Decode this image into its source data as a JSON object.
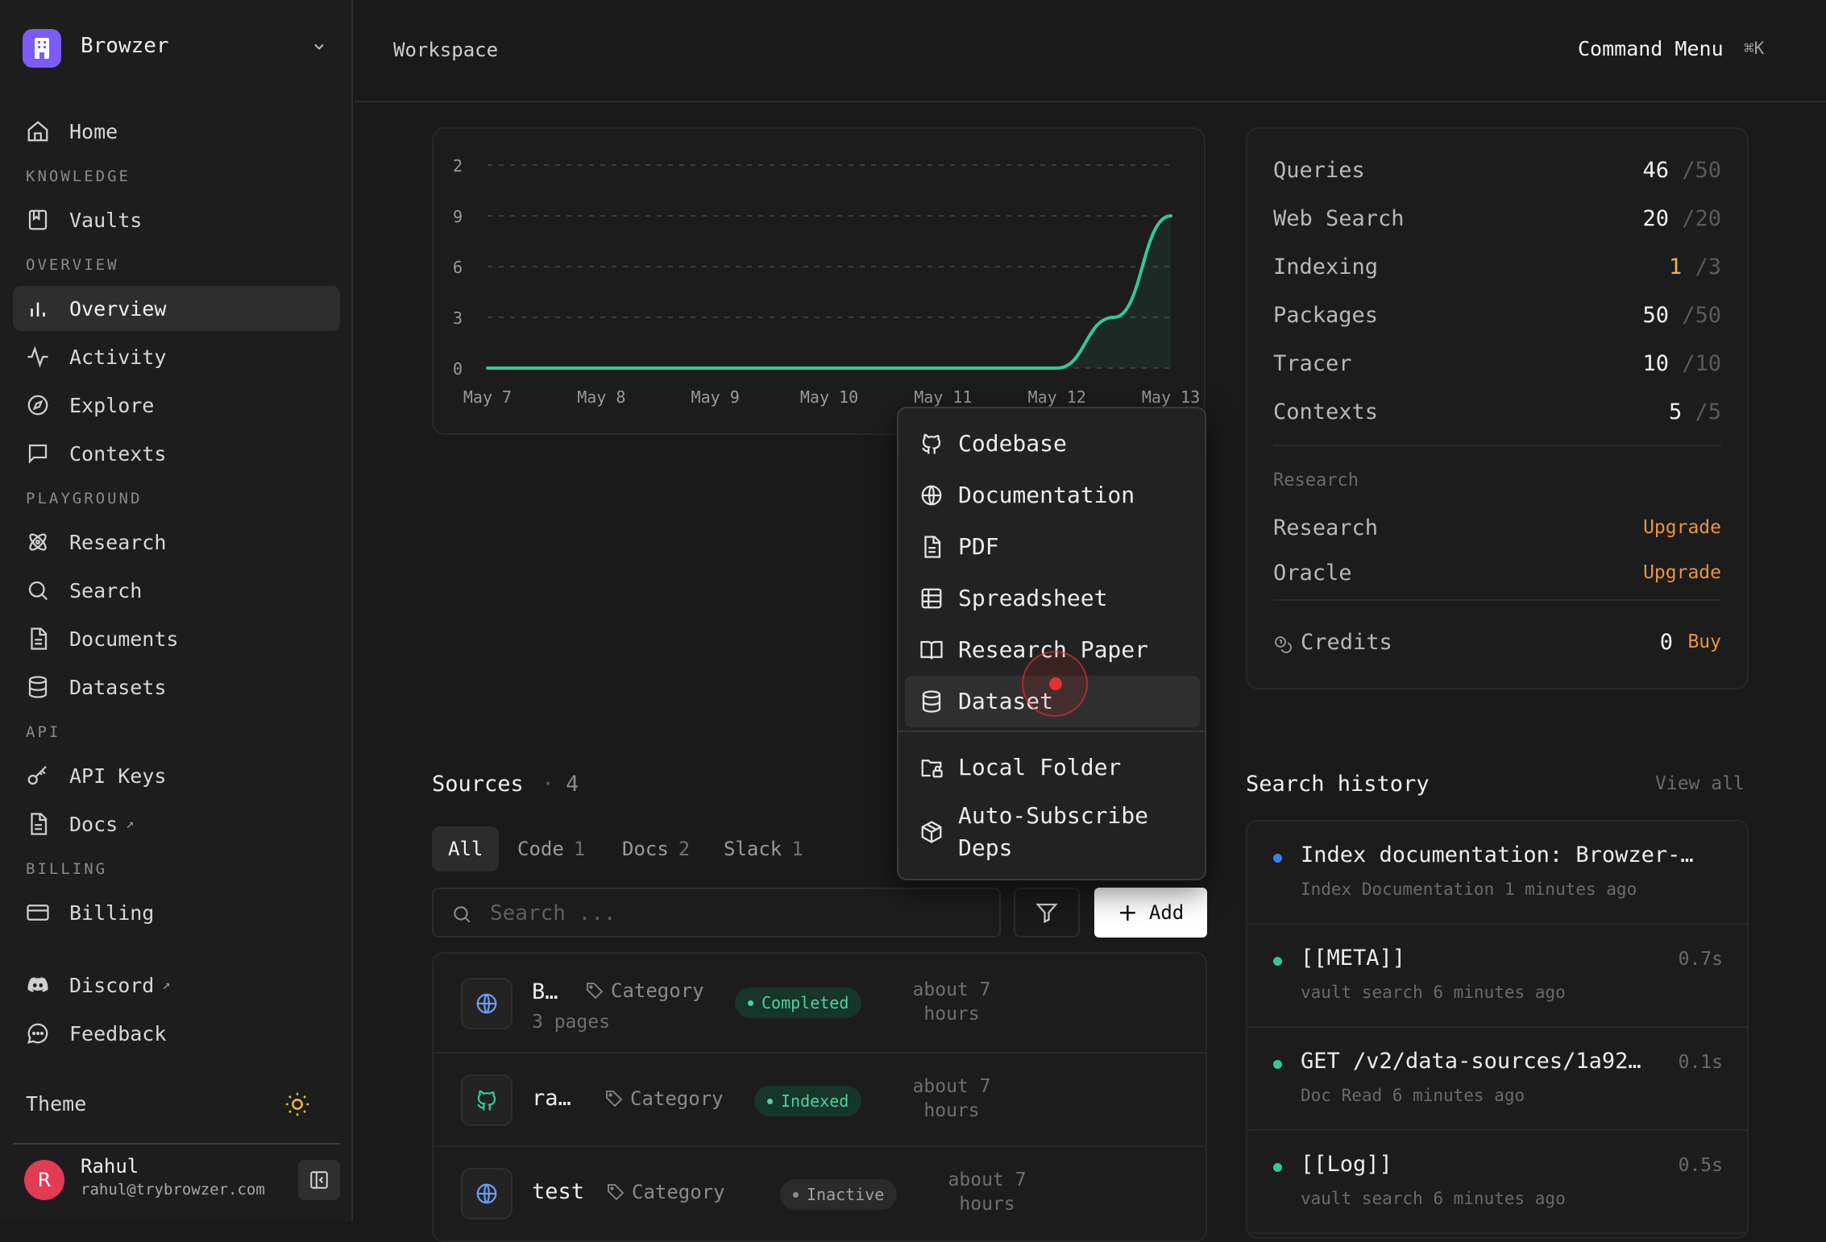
{
  "app": {
    "name": "Browzer"
  },
  "sidebar": {
    "home": "Home",
    "sections": {
      "knowledge": "KNOWLEDGE",
      "overview": "OVERVIEW",
      "playground": "PLAYGROUND",
      "api": "API",
      "billing": "BILLING"
    },
    "vaults": "Vaults",
    "overview": "Overview",
    "activity": "Activity",
    "explore": "Explore",
    "contexts": "Contexts",
    "research": "Research",
    "search": "Search",
    "documents": "Documents",
    "datasets": "Datasets",
    "api_keys": "API Keys",
    "docs": "Docs",
    "billing": "Billing",
    "discord": "Discord",
    "feedback": "Feedback",
    "external_arrow": "↗",
    "theme_label": "Theme",
    "user": {
      "initial": "R",
      "name": "Rahul",
      "email": "rahul@trybrowzer.com"
    }
  },
  "header": {
    "breadcrumb": "Workspace",
    "command_menu": "Command Menu",
    "shortcut": "⌘K"
  },
  "chart_data": {
    "type": "area",
    "title": "",
    "categories": [
      "May 7",
      "May 8",
      "May 9",
      "May 10",
      "May 11",
      "May 12",
      "May 13"
    ],
    "x": [
      "May 7",
      "May 8",
      "May 9",
      "May 10",
      "May 11",
      "May 12",
      "May 12.5",
      "May 13"
    ],
    "series": [
      {
        "values": [
          0,
          0,
          0,
          0,
          0,
          0,
          3,
          9
        ]
      }
    ],
    "y_ticks": [
      "0",
      "3",
      "6",
      "9",
      "2"
    ],
    "ylim": [
      0,
      12
    ],
    "grid": true,
    "colors": {
      "line": "#34c79a",
      "grid": "#3a3a3a"
    }
  },
  "add_menu": {
    "items": [
      {
        "label": "Codebase",
        "icon": "github-icon"
      },
      {
        "label": "Documentation",
        "icon": "globe-icon"
      },
      {
        "label": "PDF",
        "icon": "file-text-icon"
      },
      {
        "label": "Spreadsheet",
        "icon": "table-icon"
      },
      {
        "label": "Research Paper",
        "icon": "book-open-icon"
      },
      {
        "label": "Dataset",
        "icon": "database-icon"
      },
      {
        "label": "Local Folder",
        "icon": "folder-lock-icon"
      },
      {
        "label": "Auto-Subscribe Deps",
        "label_line1": "Auto-Subscribe",
        "label_line2": "Deps",
        "icon": "package-icon"
      }
    ],
    "highlighted": "Dataset"
  },
  "sources": {
    "title": "Sources",
    "dot": "·",
    "count": "4",
    "tabs": [
      {
        "label": "All",
        "count": ""
      },
      {
        "label": "Code",
        "count": "1"
      },
      {
        "label": "Docs",
        "count": "2"
      },
      {
        "label": "Slack",
        "count": "1"
      }
    ],
    "search_placeholder": "Search ...",
    "add_label": "Add",
    "rows": [
      {
        "name": "B…",
        "sub": "3 pages",
        "category": "Category",
        "status": "Completed",
        "time_line1": "about 7",
        "time_line2": "hours",
        "icon": "globe-icon"
      },
      {
        "name": "ra…",
        "sub": "",
        "category": "Category",
        "status": "Indexed",
        "time_line1": "about 7",
        "time_line2": "hours",
        "icon": "github-icon"
      },
      {
        "name": "test",
        "sub": "",
        "category": "Category",
        "status": "Inactive",
        "time_line1": "about 7",
        "time_line2": "hours",
        "icon": "globe-icon"
      }
    ]
  },
  "usage": {
    "rows": [
      {
        "label": "Queries",
        "current": "46",
        "max": "50"
      },
      {
        "label": "Web Search",
        "current": "20",
        "max": "20"
      },
      {
        "label": "Indexing",
        "current": "1",
        "max": "3"
      },
      {
        "label": "Packages",
        "current": "50",
        "max": "50"
      },
      {
        "label": "Tracer",
        "current": "10",
        "max": "10"
      },
      {
        "label": "Contexts",
        "current": "5",
        "max": "5"
      }
    ],
    "separator": "/",
    "warn_color": "#f2b33d",
    "research_section": "Research",
    "research": {
      "label": "Research",
      "action": "Upgrade"
    },
    "oracle": {
      "label": "Oracle",
      "action": "Upgrade"
    },
    "credits": {
      "label": "Credits",
      "value": "0",
      "action": "Buy"
    }
  },
  "search_history": {
    "title": "Search history",
    "view_all": "View all",
    "items": [
      {
        "text": "Index documentation: Browzer-…",
        "meta": "Index Documentation 1 minutes ago",
        "duration": "",
        "dot_color": "#3b82f6"
      },
      {
        "text": "[[META]]",
        "meta": "vault search 6 minutes ago",
        "duration": "0.7s",
        "dot_color": "#34c79a"
      },
      {
        "text": "GET /v2/data-sources/1a92…",
        "meta": "Doc Read 6 minutes ago",
        "duration": "0.1s",
        "dot_color": "#34c79a"
      },
      {
        "text": "[[Log]]",
        "meta": "vault search 6 minutes ago",
        "duration": "0.5s",
        "dot_color": "#34c79a"
      }
    ]
  }
}
